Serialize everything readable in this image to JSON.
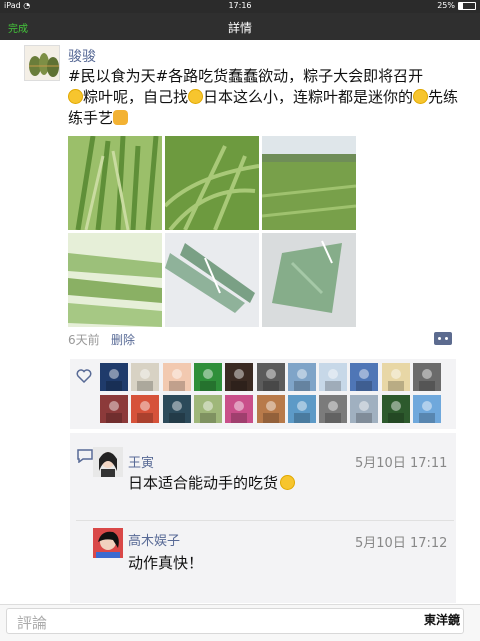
{
  "status_bar": {
    "device": "iPad",
    "time": "17:16",
    "battery": "25%",
    "battery_level": 0.25
  },
  "nav": {
    "done_label": "完成",
    "title": "詳情"
  },
  "post": {
    "author": "骏骏",
    "text_parts": [
      "#民以食为天#各路吃货蠢蠢欲动，粽子大会即将召开",
      "粽叶呢，自己找",
      "日本这么小，连粽叶都是迷你的",
      "先练练手艺"
    ],
    "time_ago": "6天前",
    "delete_label": "删除",
    "photos": [
      "reeds",
      "tall-grass",
      "rice-field",
      "leaves-stack",
      "leaves-bundle",
      "leaves-folded"
    ]
  },
  "likes": {
    "count_rows": 2,
    "avatars_row1": 11,
    "avatars_row2": 11
  },
  "comments": [
    {
      "name": "王寅",
      "time": "5月10日 17:11",
      "text": "日本适合能动手的吃货"
    },
    {
      "name": "高木娱子",
      "time": "5月10日 17:12",
      "text": "动作真快！"
    }
  ],
  "input": {
    "placeholder": "評論"
  },
  "watermark": "東洋鏡",
  "colors": {
    "accent_green": "#44c73a",
    "link_blue": "#586a96",
    "nav_dark": "#2f2f2f"
  }
}
